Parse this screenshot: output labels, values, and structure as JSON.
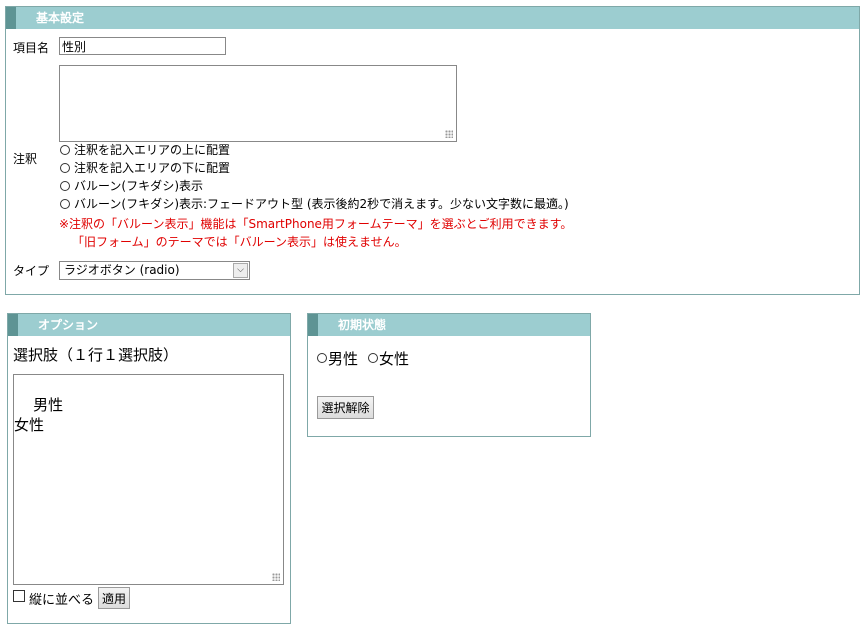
{
  "basic": {
    "header": "基本設定",
    "item_name_label": "項目名",
    "item_name_value": "性別",
    "note_label": "注釈",
    "note_value": "",
    "note_options": [
      "注釈を記入エリアの上に配置",
      "注釈を記入エリアの下に配置",
      "バルーン(フキダシ)表示",
      "バルーン(フキダシ)表示:フェードアウト型 (表示後約2秒で消えます。少ない文字数に最適。)"
    ],
    "warning_1": "※注釈の「バルーン表示」機能は「SmartPhone用フォームテーマ」を選ぶとご利用できます。",
    "warning_2": "「旧フォーム」のテーマでは「バルーン表示」は使えません。",
    "type_label": "タイプ",
    "type_value": "ラジオボタン (radio)"
  },
  "options": {
    "header": "オプション",
    "subtitle": "選択肢（１行１選択肢）",
    "choices_text": "男性\n女性",
    "vertical_label": "縦に並べる",
    "vertical_checked": false,
    "apply_label": "適用"
  },
  "initial": {
    "header": "初期状態",
    "radio_options": [
      "男性",
      "女性"
    ],
    "clear_label": "選択解除"
  },
  "colors": {
    "header_bg": "#9ccdd0",
    "header_accent": "#5e9494",
    "panel_border": "#7fa8a8",
    "warning": "#e00000"
  }
}
